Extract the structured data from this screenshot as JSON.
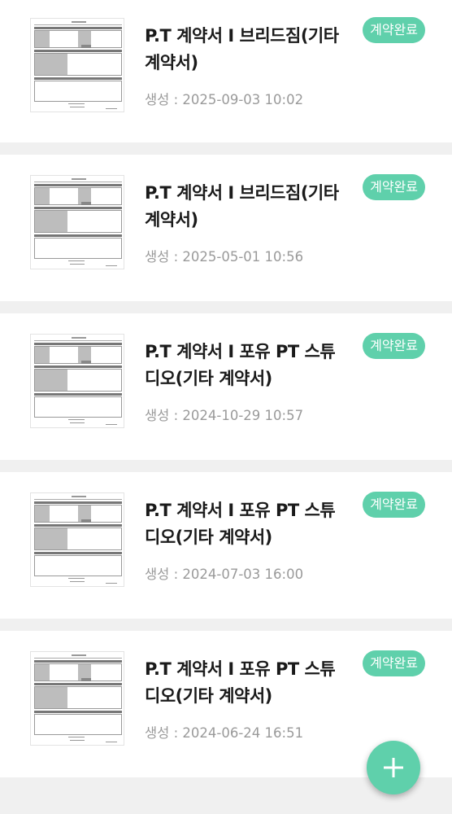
{
  "contracts": [
    {
      "title": "P.T 계약서 I 브리드짐(기타 계약서)",
      "date": "생성 : 2025-09-03 10:02",
      "status": "계약완료"
    },
    {
      "title": "P.T 계약서 I 브리드짐(기타 계약서)",
      "date": "생성 : 2025-05-01 10:56",
      "status": "계약완료"
    },
    {
      "title": "P.T 계약서 I 포유 PT 스튜디오(기타 계약서)",
      "date": "생성 : 2024-10-29 10:57",
      "status": "계약완료"
    },
    {
      "title": "P.T 계약서 I 포유 PT 스튜디오(기타 계약서)",
      "date": "생성 : 2024-07-03 16:00",
      "status": "계약완료"
    },
    {
      "title": "P.T 계약서 I 포유 PT 스튜디오(기타 계약서)",
      "date": "생성 : 2024-06-24 16:51",
      "status": "계약완료"
    }
  ],
  "fab": {
    "icon": "plus-icon"
  },
  "colors": {
    "accent": "#5fd0ab",
    "title": "#1a1a1a",
    "date": "#9a9a9a",
    "background": "#f0f0f0"
  }
}
